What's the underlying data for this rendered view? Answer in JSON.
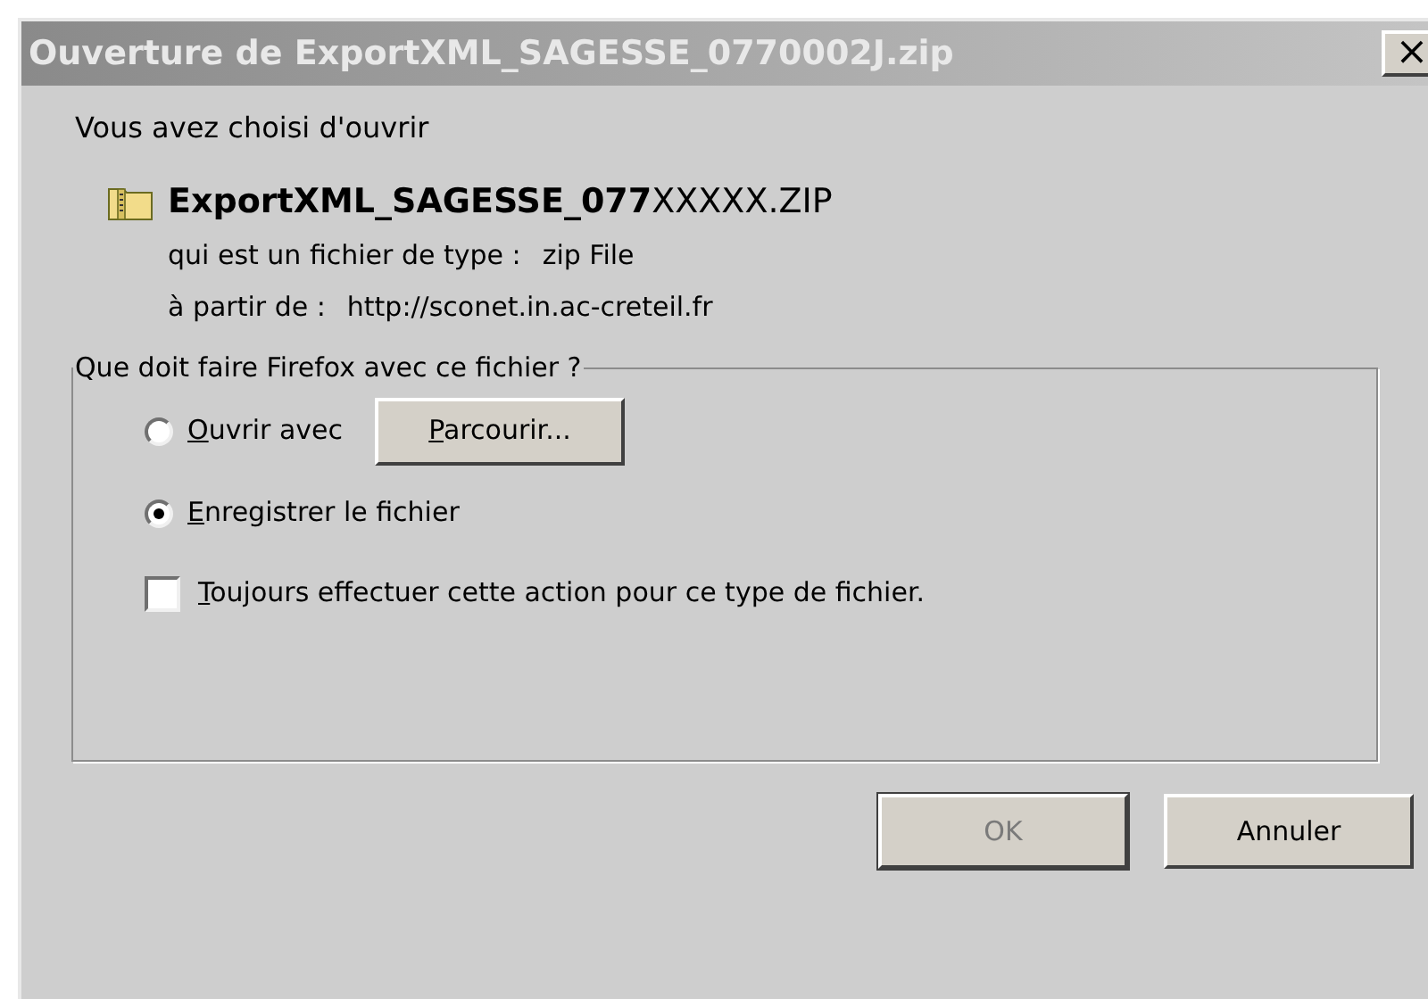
{
  "window": {
    "title": "Ouverture de ExportXML_SAGESSE_0770002J.zip",
    "close": "×"
  },
  "intro": "Vous avez choisi d'ouvrir",
  "file": {
    "name": "**ExportXML_SAGESSE_077**XXXXX.ZIP",
    "type_label": "qui est un fichier de type :",
    "type_value": "zip File",
    "from_label": "à partir de :",
    "from_value": "http://sconet.in.ac-creteil.fr"
  },
  "group": {
    "title": "Que doit faire Firefox avec ce fichier ?",
    "options": [
      {
        "label": "Ouvrir avec",
        "selected": false,
        "browse": "Parcourir..."
      },
      {
        "label": "Enregistrer le fichier",
        "selected": true
      }
    ],
    "always": {
      "label": "Toujours effectuer cette action pour ce type de fichier.",
      "checked": false
    }
  },
  "buttons": [
    {
      "label": "OK",
      "disabled": true
    },
    {
      "label": "Annuler",
      "disabled": false
    }
  ]
}
